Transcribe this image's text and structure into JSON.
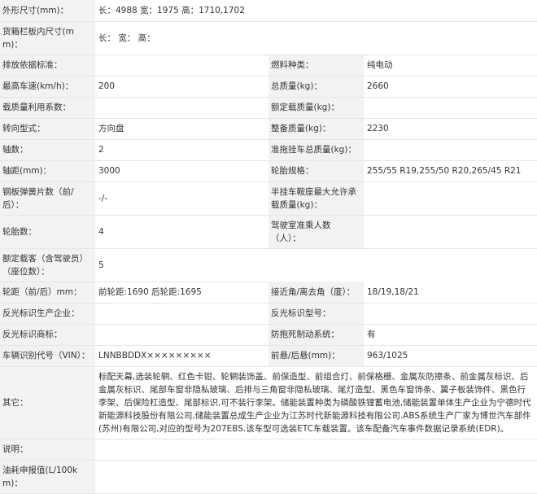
{
  "rows": [
    {
      "label": "外形尺寸(mm)：",
      "value": "长：4988 宽：1975 高：1710,1702",
      "span": true
    },
    {
      "label": "货箱栏板内尺寸(mm)：",
      "value": "长： 宽： 高：",
      "span": true
    },
    {
      "label": "排放依据标准：",
      "value": "",
      "label2": "燃料种类：",
      "value2": "纯电动"
    },
    {
      "label": "最高车速(km/h)：",
      "value": "200",
      "label2": "总质量(kg)：",
      "value2": "2660"
    },
    {
      "label": "载质量利用系数：",
      "value": "",
      "label2": "额定载质量(kg)：",
      "value2": ""
    },
    {
      "label": "转向型式：",
      "value": "方向盘",
      "label2": "整备质量(kg)：",
      "value2": "2230"
    },
    {
      "label": "轴数：",
      "value": "2",
      "label2": "准拖挂车总质量(kg)：",
      "value2": ""
    },
    {
      "label": "轴距(mm)：",
      "value": "3000",
      "label2": "轮胎规格：",
      "value2": "255/55 R19,255/50 R20,265/45 R21"
    },
    {
      "label": "钢板弹簧片数（前/后）：",
      "value": "-/-",
      "label2": "半挂车鞍座最大允许承载质量(kg)：",
      "value2": ""
    },
    {
      "label": "轮胎数：",
      "value": "4",
      "label2": "驾驶室准乘人数（人）：",
      "value2": ""
    },
    {
      "label": "额定载客（含驾驶员）（座位数）：",
      "value": "5",
      "blankRight": true
    },
    {
      "label": "轮距（前/后）mm：",
      "value": "前轮距:1690 后轮距:1695",
      "label2": "接近角/离去角（度）：",
      "value2": "18/19,18/21"
    },
    {
      "label": "反光标识生产企业：",
      "value": "",
      "label2": "反光标识型号：",
      "value2": ""
    },
    {
      "label": "反光标识商标：",
      "value": "",
      "label2": "防抱死制动系统：",
      "value2": "有"
    },
    {
      "label": "车辆识别代号（VIN）：",
      "value": "LNNBBDDX×××××××××",
      "label2": "前悬/后悬(mm)：",
      "value2": "963/1025"
    },
    {
      "label": "其它：",
      "value": "标配天幕,选装轮辋、红色卡钳、轮辋装饰盖、前保造型、前组合灯、前保格栅、金属灰防擦条、前金属灰标识、后金属灰标识、尾部车窗非隐私玻璃、后排与三角窗非隐私玻璃、尾灯造型、黑色车窗饰条、翼子板装饰件、黑色行李架、后保险杠造型、尾部标识,可不装行李架。储能装置种类为磷酸铁锂蓄电池,储能装置单体生产企业为宁德时代新能源科技股份有限公司,储能装置总成生产企业为江苏时代新能源科技有限公司.ABS系统生产厂家为博世汽车部件(苏州)有限公司,对应的型号为207EBS.该车型可选装ETC车载装置。该车配备汽车事件数据记录系统(EDR)。",
      "span": true
    },
    {
      "label": "说明：",
      "value": "",
      "span": true
    },
    {
      "label": "油耗申报值(L/100km)：",
      "value": "",
      "span": true
    }
  ]
}
